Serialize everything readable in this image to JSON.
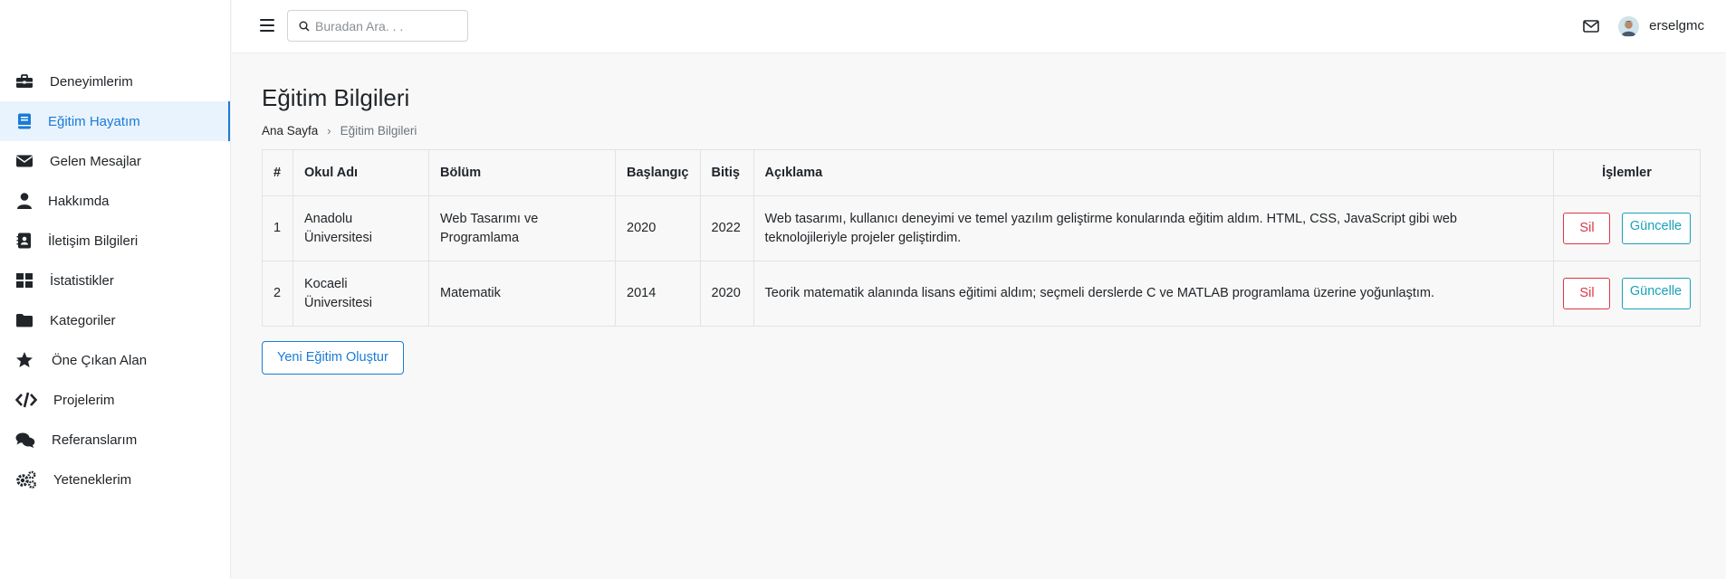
{
  "sidebar": {
    "items": [
      {
        "label": "Deneyimlerim",
        "icon": "briefcase-icon"
      },
      {
        "label": "Eğitim Hayatım",
        "icon": "book-icon",
        "active": true
      },
      {
        "label": "Gelen Mesajlar",
        "icon": "envelope-icon"
      },
      {
        "label": "Hakkımda",
        "icon": "user-icon"
      },
      {
        "label": "İletişim Bilgileri",
        "icon": "contact-card-icon"
      },
      {
        "label": "İstatistikler",
        "icon": "grid-icon"
      },
      {
        "label": "Kategoriler",
        "icon": "folder-icon"
      },
      {
        "label": "Öne Çıkan Alan",
        "icon": "star-icon"
      },
      {
        "label": "Projelerim",
        "icon": "code-icon"
      },
      {
        "label": "Referanslarım",
        "icon": "comments-icon"
      },
      {
        "label": "Yeteneklerim",
        "icon": "gears-icon"
      }
    ]
  },
  "header": {
    "search_placeholder": "Buradan Ara. . .",
    "username": "erselgmc"
  },
  "page": {
    "title": "Eğitim Bilgileri",
    "breadcrumb": {
      "home": "Ana Sayfa",
      "current": "Eğitim Bilgileri"
    }
  },
  "table": {
    "headers": {
      "num": "#",
      "okul": "Okul Adı",
      "bolum": "Bölüm",
      "baslangic": "Başlangıç",
      "bitis": "Bitiş",
      "aciklama": "Açıklama",
      "islemler": "İşlemler"
    },
    "rows": [
      {
        "num": "1",
        "okul": "Anadolu Üniversitesi",
        "bolum": "Web Tasarımı ve Programlama",
        "baslangic": "2020",
        "bitis": "2022",
        "aciklama": "Web tasarımı, kullanıcı deneyimi ve temel yazılım geliştirme konularında eğitim aldım. HTML, CSS, JavaScript gibi web teknolojileriyle projeler geliştirdim.",
        "sil": "Sil",
        "guncelle": "Güncelle"
      },
      {
        "num": "2",
        "okul": "Kocaeli Üniversitesi",
        "bolum": "Matematik",
        "baslangic": "2014",
        "bitis": "2020",
        "aciklama": "Teorik matematik alanında lisans eğitimi aldım; seçmeli derslerde C ve MATLAB programlama üzerine yoğunlaştım.",
        "sil": "Sil",
        "guncelle": "Güncelle"
      }
    ]
  },
  "actions": {
    "new_label": "Yeni Eğitim Oluştur"
  },
  "colors": {
    "accent": "#1a7bd6",
    "danger": "#dc3545",
    "info": "#17a2b8"
  }
}
